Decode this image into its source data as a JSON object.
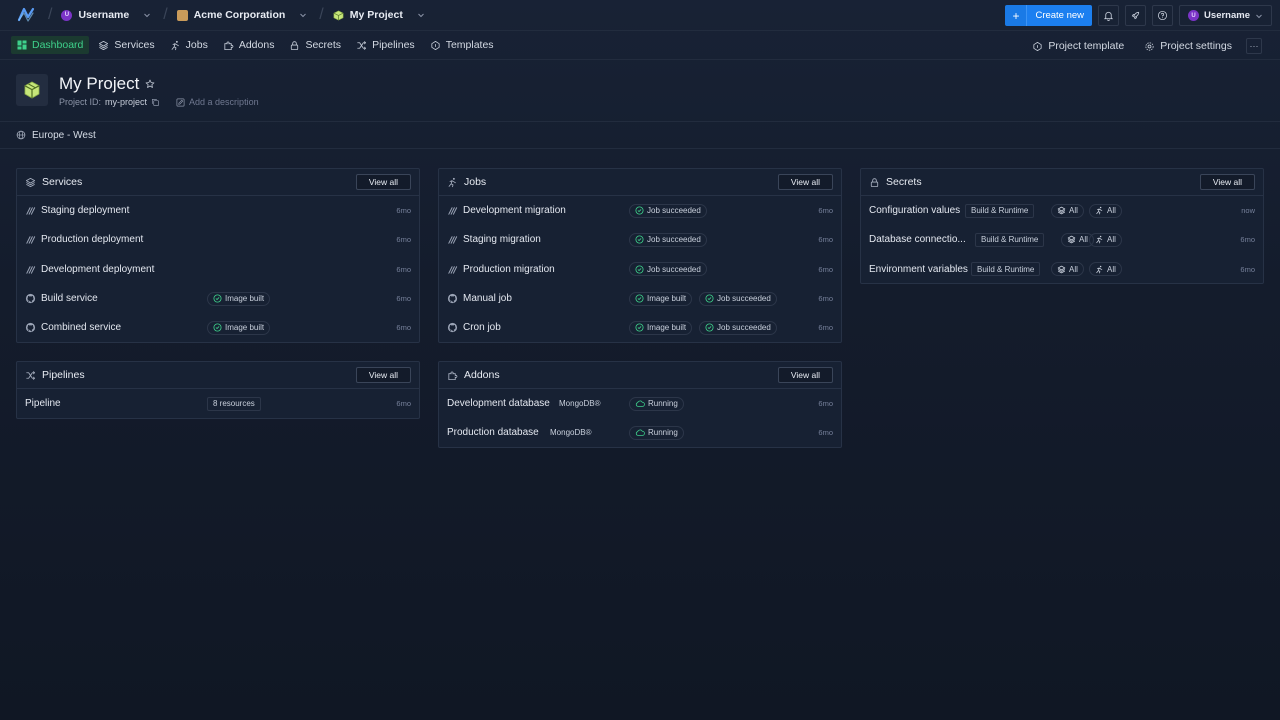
{
  "topbar": {
    "user": "Username",
    "user_initial": "U",
    "org": "Acme Corporation",
    "project": "My Project",
    "create_label": "Create new",
    "user_right": "Username"
  },
  "nav": {
    "items": [
      "Dashboard",
      "Services",
      "Jobs",
      "Addons",
      "Secrets",
      "Pipelines",
      "Templates"
    ],
    "project_template": "Project template",
    "project_settings": "Project settings"
  },
  "project": {
    "title": "My Project",
    "id_label": "Project ID:",
    "id": "my-project",
    "add_description": "Add a description",
    "region": "Europe - West"
  },
  "cards": {
    "view_all": "View all",
    "services": {
      "title": "Services",
      "rows": [
        {
          "name": "Staging deployment",
          "time": "6mo"
        },
        {
          "name": "Production deployment",
          "time": "6mo"
        },
        {
          "name": "Development deployment",
          "time": "6mo"
        },
        {
          "name": "Build service",
          "tag": "Image built",
          "time": "6mo"
        },
        {
          "name": "Combined service",
          "tag": "Image built",
          "time": "6mo"
        }
      ]
    },
    "jobs": {
      "title": "Jobs",
      "rows": [
        {
          "name": "Development migration",
          "tag2": "Job succeeded",
          "time": "6mo"
        },
        {
          "name": "Staging migration",
          "tag2": "Job succeeded",
          "time": "6mo"
        },
        {
          "name": "Production migration",
          "tag2": "Job succeeded",
          "time": "6mo"
        },
        {
          "name": "Manual job",
          "tag1": "Image built",
          "tag2": "Job succeeded",
          "time": "6mo"
        },
        {
          "name": "Cron job",
          "tag1": "Image built",
          "tag2": "Job succeeded",
          "time": "6mo"
        }
      ]
    },
    "secrets": {
      "title": "Secrets",
      "rows": [
        {
          "name": "Configuration values",
          "scope": "Build & Runtime",
          "services": "All",
          "jobs": "All",
          "time": "now"
        },
        {
          "name": "Database connectio...",
          "scope": "Build & Runtime",
          "services": "All",
          "jobs": "All",
          "time": "6mo"
        },
        {
          "name": "Environment variables",
          "scope": "Build & Runtime",
          "services": "All",
          "jobs": "All",
          "time": "6mo"
        }
      ]
    },
    "pipelines": {
      "title": "Pipelines",
      "rows": [
        {
          "name": "Pipeline",
          "tag": "8 resources",
          "time": "6mo"
        }
      ]
    },
    "addons": {
      "title": "Addons",
      "rows": [
        {
          "name": "Development database",
          "type": "MongoDB®",
          "status": "Running",
          "time": "6mo"
        },
        {
          "name": "Production database",
          "type": "MongoDB®",
          "status": "Running",
          "time": "6mo"
        }
      ]
    }
  },
  "colors": {
    "accent_blue": "#1c7ff0",
    "active_green": "#3ed18b",
    "success_green": "#3ed18b"
  }
}
